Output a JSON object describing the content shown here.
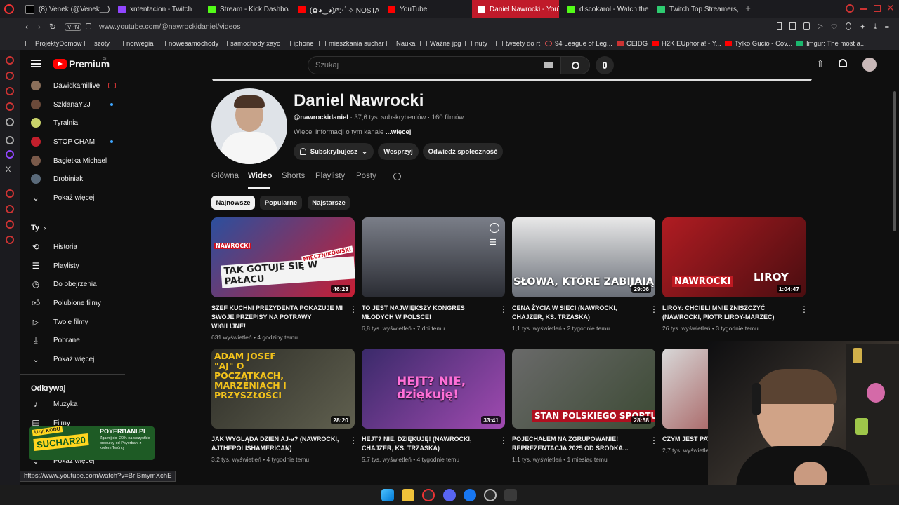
{
  "browser": {
    "tabs": [
      {
        "label": "(8) Venek (@Venek__) / X",
        "color": "#000000"
      },
      {
        "label": "xntentacion - Twitch",
        "color": "#9146ff"
      },
      {
        "label": "Stream - Kick Dashboard",
        "color": "#53fc18"
      },
      {
        "label": "(✿◕‿◕)/*:･ﾟ✧ NOSTALGI",
        "color": "#ff0000"
      },
      {
        "label": "YouTube",
        "color": "#ff0000"
      },
      {
        "label": "Daniel Nawrocki - YouTu",
        "color": "#ff0000"
      },
      {
        "label": "discokarol - Watch the VO",
        "color": "#53fc18"
      },
      {
        "label": "Twitch Top Streamers, De",
        "color": "#2ecc71"
      }
    ],
    "url": "www.youtube.com/@nawrockidaniel/videos",
    "vpn_label": "VPN",
    "bookmarks": [
      "ProjektyDomow",
      "szoty",
      "norwegia",
      "nowesamochody",
      "samochody xayo",
      "iphone",
      "mieszkania suchar",
      "Nauka",
      "Ważne jpg",
      "nuty",
      "tweety do rt",
      "94 League of Leg...",
      "CEIDG",
      "H2K EUphoria! - Y...",
      "Tylko Gucio - Cov...",
      "Imgur: The most a..."
    ]
  },
  "yt": {
    "logo": "Premium",
    "logo_region": "PL",
    "search_placeholder": "Szukaj"
  },
  "sidebar": {
    "subscriptions": [
      {
        "name": "Dawidkamillive",
        "color": "#8a6f5a"
      },
      {
        "name": "SzklanaY2J",
        "color": "#6b4a3a"
      },
      {
        "name": "Tyralnia",
        "color": "#c9d36a"
      },
      {
        "name": "STOP CHAM",
        "color": "#c21f2c"
      },
      {
        "name": "Bagietka Michael",
        "color": "#7a5a4a"
      },
      {
        "name": "Drobiniak",
        "color": "#5a6a7a"
      }
    ],
    "show_more": "Pokaż więcej",
    "you_header": "Ty",
    "you_items": [
      "Historia",
      "Playlisty",
      "Do obejrzenia",
      "Polubione filmy",
      "Twoje filmy",
      "Pobrane"
    ],
    "show_more2": "Pokaż więcej",
    "explore_header": "Odkrywaj",
    "explore_items": [
      "Muzyka",
      "Filmy"
    ],
    "show_more3": "Pokaż więcej"
  },
  "channel": {
    "name": "Daniel Nawrocki",
    "handle": "@nawrockidaniel",
    "subs": " · 37,6 tys. subskrybentów · 160 filmów",
    "desc": "Więcej informacji o tym kanale ",
    "desc_more": "...więcej",
    "btn_subscribed": "Subskrybujesz",
    "btn_support": "Wesprzyj",
    "btn_community": "Odwiedź społeczność",
    "tabs": [
      "Główna",
      "Wideo",
      "Shorts",
      "Playlisty",
      "Posty"
    ],
    "chips": [
      "Najnowsze",
      "Popularne",
      "Najstarsze"
    ]
  },
  "videos": [
    {
      "title": "SZEF KUCHNI PREZYDENTA POKAZUJE MI SWOJE PRZEPISY NA POTRAWY WIGILIJNE!",
      "meta": "631 wyświetleń • 4 godziny temu",
      "duration": "46:23",
      "overlay": "TAK GOTUJE SIĘ W PAŁACU",
      "tags": [
        "NAWROCKI",
        "MIECZNIKOWSKI"
      ],
      "bg": "#3c5fa8"
    },
    {
      "title": "TO JEST NAJWIĘKSZY KONGRES MŁODYCH W POLSCE!",
      "meta": "6,8 tys. wyświetleń • 7 dni temu",
      "duration": "",
      "overlay": "",
      "tags": [],
      "bg": "#3a3d48"
    },
    {
      "title": "CENA ŻYCIA W SIECI (NAWROCKI, CHAJZER, KS. TRZASKA)",
      "meta": "1,1 tys. wyświetleń • 2 tygodnie temu",
      "duration": "29:06",
      "overlay": "SŁOWA, KTÓRE ZABIJAJĄ",
      "tags": [],
      "bg": "#5b6470"
    },
    {
      "title": "LIROY: CHCIELI MNIE ZNISZCZYĆ (NAWROCKI, PIOTR LIROY-MARZEC)",
      "meta": "26 tys. wyświetleń • 3 tygodnie temu",
      "duration": "1:04:47",
      "overlay": "",
      "tags": [
        "NAWROCKI",
        "LIROY"
      ],
      "bg": "#9a1c20"
    },
    {
      "title": "JAK WYGLĄDA DZIEŃ AJ-a? (NAWROCKI, AJTHEPOLISHAMERICAN)",
      "meta": "3,2 tys. wyświetleń • 4 tygodnie temu",
      "duration": "28:20",
      "overlay": "ADAM JOSEF \"AJ\" O POCZĄTKACH, MARZENIACH I PRZYSZŁOŚCI",
      "tags": [],
      "bg": "#4a4a42"
    },
    {
      "title": "HEJT? NIE, DZIĘKUJĘ! (NAWROCKI, CHAJZER, KS. TRZASKA)",
      "meta": "5,7 tys. wyświetleń • 4 tygodnie temu",
      "duration": "33:41",
      "overlay": "HEJT? NIE, dziękuję!",
      "tags": [],
      "bg": "#6a2e8a"
    },
    {
      "title": "POJECHAŁEM NA ZGRUPOWANIE! REPREZENTACJA 2025 OD ŚRODKA...",
      "meta": "1,1 tys. wyświetleń • 1 miesiąc temu",
      "duration": "28:58",
      "overlay": "STAN POLSKIEGO SPORTU",
      "tags": [],
      "bg": "#4f5a4a"
    },
    {
      "title": "CZYM JEST PAT... BĄKIEWICZ, WA...",
      "meta": "2,7 tys. wyświetleń •",
      "duration": "",
      "overlay": "",
      "tags": [],
      "bg": "#8a1b1b"
    }
  ],
  "status_url": "https://www.youtube.com/watch?v=BrIBmymXchE",
  "promo": {
    "brand": "POYERBANI.PL",
    "code": "SUCHAR20",
    "line1": "Użyj KODU",
    "text": "Zgarnij do -20% na wszystkie produkty od Poyerbani z kodem Twórcy"
  }
}
